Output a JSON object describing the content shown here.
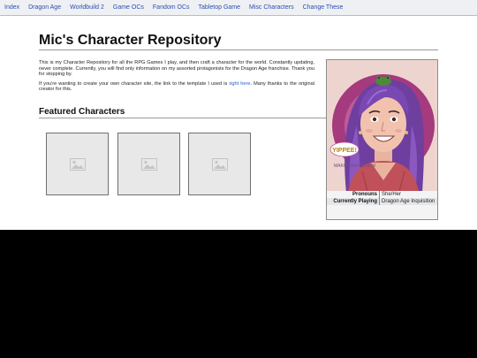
{
  "nav": {
    "items": [
      "Index",
      "Dragon Age",
      "Worldbuild 2",
      "Game OCs",
      "Fandom OCs",
      "Tabletop Game",
      "Misc Characters",
      "Change These"
    ]
  },
  "page": {
    "title": "Mic's Character Repository",
    "intro_1": "This is my Character Repository for all the RPG Games I play, and then craft a character for the world. Constantly updating, never complete. Currently, you will find only information on my assorted protagonists for the Dragon Age franchise. Thank you for stopping by.",
    "intro_2_before": "If you're wanting to create your own character site, the link to the template I used is ",
    "intro_2_link": "right here",
    "intro_2_after": ". Many thanks to the original creator for this.",
    "featured_heading": "Featured Characters"
  },
  "infobox": {
    "portrait_text_1": "YIPPEE!",
    "portrait_text_2": "MAKOWKA PICREW",
    "rows": [
      {
        "key": "Pronouns",
        "value": "She/Her"
      },
      {
        "key": "Currently Playing",
        "value": "Dragon Age Inquisition"
      }
    ]
  },
  "colors": {
    "link": "#2a56c6",
    "nav_bg": "#eef0f4",
    "footer_bg": "#000000"
  }
}
